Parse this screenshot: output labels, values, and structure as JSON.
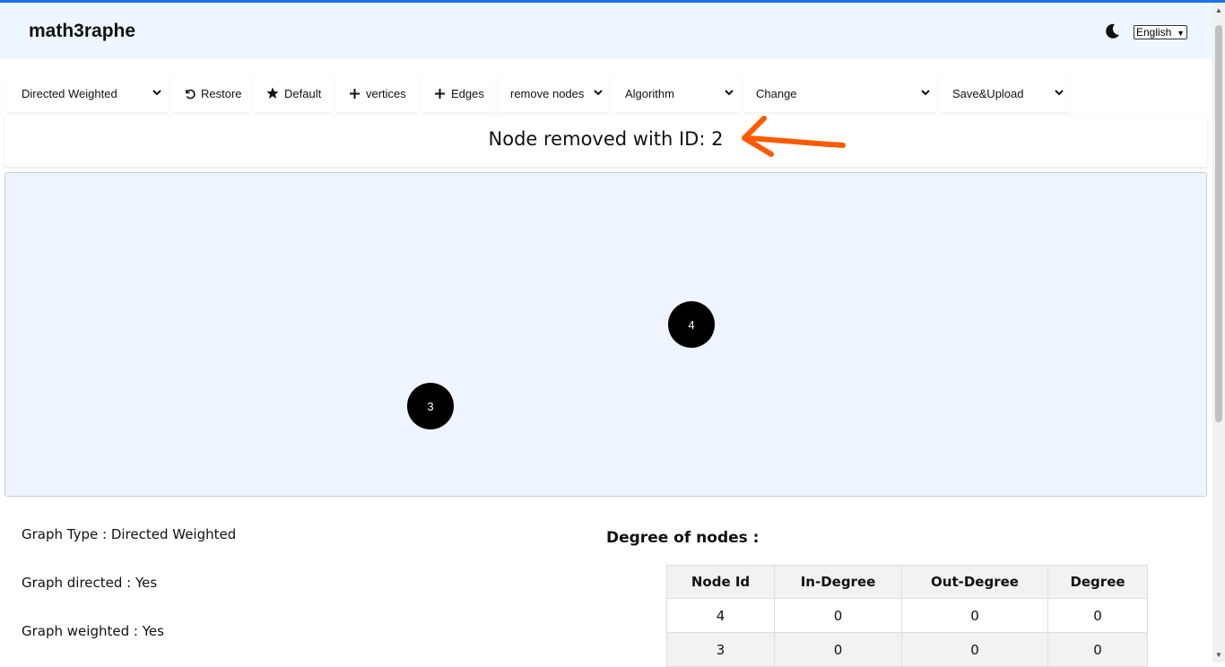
{
  "app": {
    "title": "math3raphe"
  },
  "header": {
    "theme_icon": "moon-icon",
    "language": "English"
  },
  "toolbar": {
    "graph_type": "Directed Weighted",
    "restore": "Restore",
    "default": "Default",
    "vertices": "vertices",
    "edges": "Edges",
    "remove_nodes": "remove nodes",
    "algorithm": "Algorithm",
    "change": "Change",
    "save_upload": "Save&Upload"
  },
  "message": "Node removed with ID: 2",
  "annotation": {
    "color": "#ff5a00"
  },
  "graph": {
    "nodes": [
      {
        "id": "4"
      },
      {
        "id": "3"
      }
    ]
  },
  "info": {
    "type": "Graph Type : Directed Weighted",
    "directed": "Graph directed : Yes",
    "weighted": "Graph weighted : Yes"
  },
  "degrees": {
    "title": "Degree of nodes :",
    "headers": [
      "Node Id",
      "In-Degree",
      "Out-Degree",
      "Degree"
    ],
    "rows": [
      [
        "4",
        "0",
        "0",
        "0"
      ],
      [
        "3",
        "0",
        "0",
        "0"
      ]
    ]
  },
  "colors": {
    "accent": "#1a73e8",
    "header_bg": "#eef6ff",
    "canvas_bg": "#eef5ff"
  }
}
